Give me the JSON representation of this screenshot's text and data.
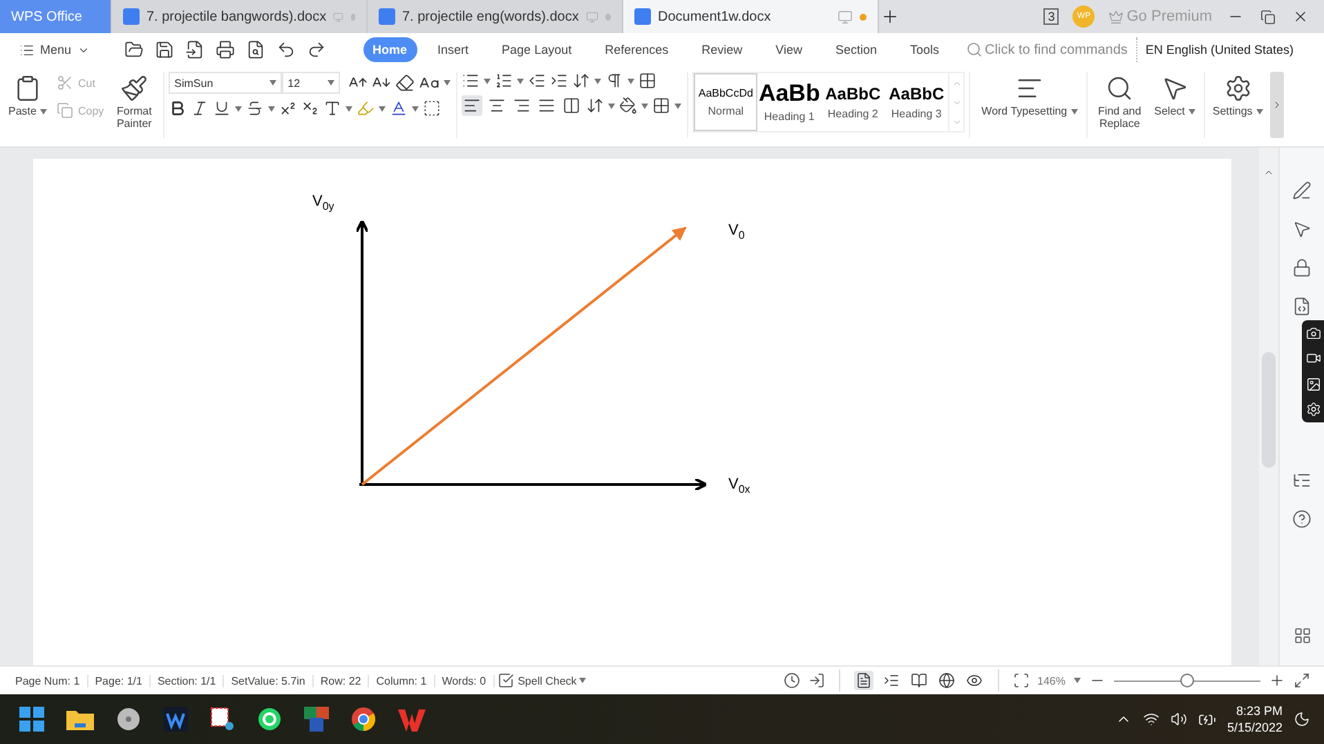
{
  "home_tab": "WPS Office",
  "tabs": [
    {
      "label": "7. projectile bangwords).docx",
      "kind": "doc",
      "selected": false,
      "modified": false
    },
    {
      "label": "7. projectile eng(words).docx",
      "kind": "doc",
      "selected": false,
      "modified": false
    },
    {
      "label": "Document1w.docx",
      "kind": "doc",
      "selected": true,
      "modified": true
    }
  ],
  "title_bar": {
    "badge": "3",
    "avatar": "WP",
    "premium": "Go Premium"
  },
  "menu": "Menu",
  "ribbon_tabs": [
    {
      "label": "Home",
      "selected": true
    },
    {
      "label": "Insert",
      "selected": false
    },
    {
      "label": "Page Layout",
      "selected": false
    },
    {
      "label": "References",
      "selected": false
    },
    {
      "label": "Review",
      "selected": false
    },
    {
      "label": "View",
      "selected": false
    },
    {
      "label": "Section",
      "selected": false
    },
    {
      "label": "Tools",
      "selected": false
    }
  ],
  "search": {
    "placeholder": "Click to find commands"
  },
  "language": "EN English (United States)",
  "clipboard": {
    "paste": "Paste",
    "cut": "Cut",
    "copy": "Copy",
    "painter": "Format Painter"
  },
  "font": {
    "name": "SimSun",
    "size": "12"
  },
  "alignments": [
    {
      "kind": "left",
      "selected": true
    },
    {
      "kind": "center",
      "selected": false
    },
    {
      "kind": "right",
      "selected": false
    },
    {
      "kind": "justify",
      "selected": false
    },
    {
      "kind": "distributed",
      "selected": false
    }
  ],
  "styles": [
    {
      "preview": "AaBbCcDd",
      "label": "Normal",
      "kind": "normal",
      "selected": true
    },
    {
      "preview": "AaBb",
      "label": "Heading 1",
      "kind": "h1",
      "selected": false
    },
    {
      "preview": "AaBbC",
      "label": "Heading 2",
      "kind": "h2",
      "selected": false
    },
    {
      "preview": "AaBbC",
      "label": "Heading 3",
      "kind": "h3",
      "selected": false
    }
  ],
  "tools": {
    "typesetting": "Word Typesetting",
    "find": "Find and Replace",
    "select": "Select",
    "settings": "Settings"
  },
  "diagram": {
    "labels": [
      "V$_{0y}$",
      "V$_{0}$",
      "V$_{0x}$"
    ]
  },
  "status": [
    "Page Num: 1",
    "Page: 1/1",
    "Section: 1/1",
    "SetValue: 5.7in",
    "Row: 22",
    "Column: 1",
    "Words: 0"
  ],
  "spell_check": "Spell Check",
  "views": [
    {
      "kind": "page",
      "selected": true
    },
    {
      "kind": "outline",
      "selected": false
    },
    {
      "kind": "read",
      "selected": false
    },
    {
      "kind": "web",
      "selected": false
    },
    {
      "kind": "eye",
      "selected": false
    }
  ],
  "zoom": {
    "label": "146%",
    "level": 0.5
  },
  "clock": {
    "time": "8:23 PM",
    "date": "5/15/2022"
  }
}
